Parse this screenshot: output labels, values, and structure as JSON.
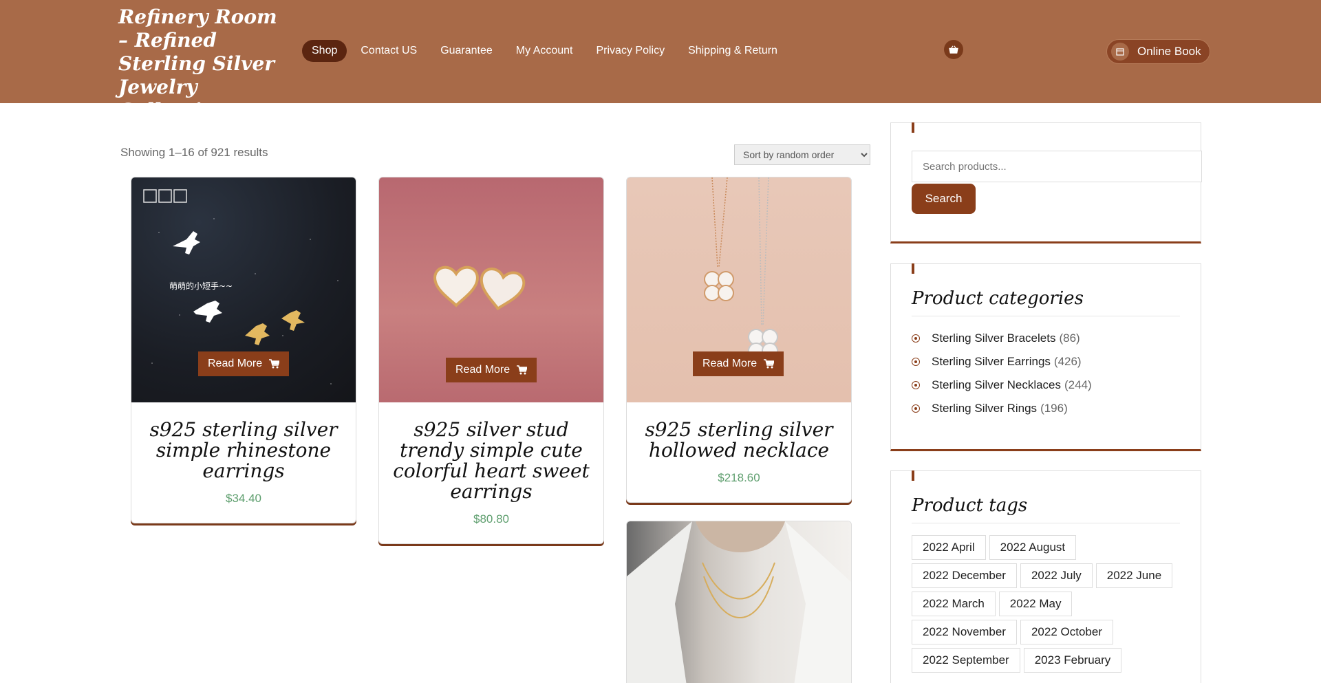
{
  "site": {
    "title": "Refinery Room – Refined Sterling Silver Jewelry Collections"
  },
  "nav": [
    {
      "label": "Shop",
      "active": true
    },
    {
      "label": "Contact US"
    },
    {
      "label": "Guarantee"
    },
    {
      "label": "My Account"
    },
    {
      "label": "Privacy Policy"
    },
    {
      "label": "Shipping & Return"
    }
  ],
  "header": {
    "book_label": "Online Book"
  },
  "shop": {
    "result_count": "Showing 1–16 of 921 results",
    "sort_selected": "Sort by random order",
    "read_more_label": "Read More",
    "products": [
      {
        "title": "s925 sterling silver simple rhinestone earrings",
        "price": "$34.40",
        "image_text": "萌萌的小短手~~"
      },
      {
        "title": "s925 silver stud trendy simple cute colorful heart sweet earrings",
        "price": "$80.80"
      },
      {
        "title": "s925 sterling silver hollowed necklace",
        "price": "$218.60"
      }
    ]
  },
  "sidebar": {
    "search": {
      "placeholder": "Search products...",
      "button": "Search"
    },
    "categories": {
      "title": "Product categories",
      "items": [
        {
          "label": "Sterling Silver Bracelets",
          "count": "(86)"
        },
        {
          "label": "Sterling Silver Earrings",
          "count": "(426)"
        },
        {
          "label": "Sterling Silver Necklaces",
          "count": "(244)"
        },
        {
          "label": "Sterling Silver Rings",
          "count": "(196)"
        }
      ]
    },
    "tags": {
      "title": "Product tags",
      "items": [
        "2022 April",
        "2022 August",
        "2022 December",
        "2022 July",
        "2022 June",
        "2022 March",
        "2022 May",
        "2022 November",
        "2022 October",
        "2022 September",
        "2023 February"
      ]
    }
  },
  "colors": {
    "header": "#a86a48",
    "accent": "#8a3e1a",
    "price": "#5f9f6f"
  }
}
